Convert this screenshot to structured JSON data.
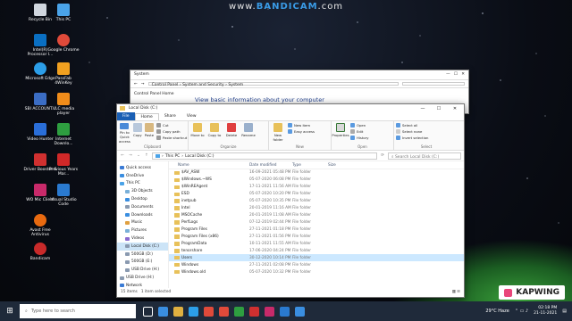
{
  "watermark": {
    "prefix": "www.",
    "brand": "BANDICAM",
    "suffix": ".com"
  },
  "desktop_icons": [
    {
      "label": "Recycle Bin",
      "color": "#d0d6de"
    },
    {
      "label": "This PC",
      "color": "#4aa3e8"
    },
    {
      "label": "Intel(R) Processor I...",
      "color": "#0a6fc2"
    },
    {
      "label": "Google Chrome",
      "color": "#e04a3a"
    },
    {
      "label": "Microsoft Edge",
      "color": "#2c9ee8"
    },
    {
      "label": "PassFab 4WinKey",
      "color": "#f0a020"
    },
    {
      "label": "SBI ACCOUNT...",
      "color": "#3b6dc4"
    },
    {
      "label": "VLC media player",
      "color": "#f08c1a"
    },
    {
      "label": "Video Hunter",
      "color": "#2a6ed8"
    },
    {
      "label": "Internet Downlo...",
      "color": "#2e9e40"
    },
    {
      "label": "Driver Booster 6",
      "color": "#d03030"
    },
    {
      "label": "Previous Years Mar...",
      "color": "#d02828"
    },
    {
      "label": "WO Mic Client",
      "color": "#c82a6a"
    },
    {
      "label": "Visual Studio Code",
      "color": "#2a7ad0"
    },
    {
      "label": "Avast Free Antivirus",
      "color": "#e86a10"
    },
    {
      "label": "Bandicam",
      "color": "#c82a2a"
    }
  ],
  "system_window": {
    "title": "System",
    "breadcrumb": [
      "Control Panel",
      "System and Security",
      "System"
    ],
    "side_link": "Control Panel Home",
    "heading": "View basic information about your computer"
  },
  "explorer": {
    "title": "Local Disk (C:)",
    "controls": {
      "minimize": "—",
      "maximize": "☐",
      "close": "✕"
    },
    "tabs": [
      "File",
      "Home",
      "Share",
      "View"
    ],
    "ribbon": {
      "clipboard": {
        "name": "Clipboard",
        "pin": "Pin to Quick access",
        "copy": "Copy",
        "paste": "Paste",
        "cut": "Cut",
        "copy_path": "Copy path",
        "paste_shortcut": "Paste shortcut"
      },
      "organize": {
        "name": "Organize",
        "move_to": "Move to",
        "copy_to": "Copy to",
        "delete": "Delete",
        "rename": "Rename"
      },
      "new": {
        "name": "New",
        "new_folder": "New folder",
        "new_item": "New item",
        "easy_access": "Easy access"
      },
      "open": {
        "name": "Open",
        "properties": "Properties",
        "open": "Open",
        "edit": "Edit",
        "history": "History"
      },
      "select": {
        "name": "Select",
        "select_all": "Select all",
        "select_none": "Select none",
        "invert": "Invert selection"
      }
    },
    "address": {
      "parts": [
        "This PC",
        "Local Disk (C:)"
      ],
      "search_placeholder": "Search Local Disk (C:)"
    },
    "nav_pane": [
      {
        "label": "Quick access",
        "color": "#3a7bd5"
      },
      {
        "label": "OneDrive",
        "color": "#3a8ee0"
      },
      {
        "label": "This PC",
        "color": "#4aa3e8"
      },
      {
        "label": "3D Objects",
        "color": "#7ab0d8"
      },
      {
        "label": "Desktop",
        "color": "#3a8ee0"
      },
      {
        "label": "Documents",
        "color": "#8a9ab0"
      },
      {
        "label": "Downloads",
        "color": "#3a8ee0"
      },
      {
        "label": "Music",
        "color": "#e0a040"
      },
      {
        "label": "Pictures",
        "color": "#7ab0d8"
      },
      {
        "label": "Videos",
        "color": "#8a6ad0"
      },
      {
        "label": "Local Disk (C:)",
        "color": "#8a9ab0"
      },
      {
        "label": "500GB (D:)",
        "color": "#8a9ab0"
      },
      {
        "label": "500GB (E:)",
        "color": "#8a9ab0"
      },
      {
        "label": "USB Drive (H:)",
        "color": "#8a9ab0"
      },
      {
        "label": "USB Drive (H:)",
        "color": "#8a9ab0"
      },
      {
        "label": "Network",
        "color": "#3a7bd5"
      }
    ],
    "columns": {
      "name": "Name",
      "date": "Date modified",
      "type": "Type",
      "size": "Size"
    },
    "files": [
      {
        "name": "$AV_ASW",
        "date": "16-09-2021 05:48 PM",
        "type": "File folder"
      },
      {
        "name": "$Windows.~WS",
        "date": "05-07-2020 06:08 PM",
        "type": "File folder"
      },
      {
        "name": "$WinREAgent",
        "date": "17-11-2021 11:56 AM",
        "type": "File folder"
      },
      {
        "name": "ESD",
        "date": "05-07-2020 10:20 PM",
        "type": "File folder"
      },
      {
        "name": "inetpub",
        "date": "05-07-2020 10:35 PM",
        "type": "File folder"
      },
      {
        "name": "Intel",
        "date": "20-01-2019 11:16 AM",
        "type": "File folder"
      },
      {
        "name": "MSOCache",
        "date": "20-01-2019 11:08 AM",
        "type": "File folder"
      },
      {
        "name": "PerfLogs",
        "date": "07-12-2019 02:44 PM",
        "type": "File folder"
      },
      {
        "name": "Program Files",
        "date": "27-11-2021 01:18 PM",
        "type": "File folder"
      },
      {
        "name": "Program Files (x86)",
        "date": "27-11-2021 01:56 PM",
        "type": "File folder"
      },
      {
        "name": "ProgramData",
        "date": "10-11-2021 11:55 AM",
        "type": "File folder"
      },
      {
        "name": "tenorshare",
        "date": "17-06-2020 04:24 PM",
        "type": "File folder"
      },
      {
        "name": "Users",
        "date": "30-12-2020 10:14 PM",
        "type": "File folder"
      },
      {
        "name": "Windows",
        "date": "27-11-2021 02:08 PM",
        "type": "File folder"
      },
      {
        "name": "Windows.old",
        "date": "05-07-2020 10:32 PM",
        "type": "File folder"
      }
    ],
    "selected_index": 12,
    "status": {
      "items": "15 items",
      "selected": "1 item selected"
    }
  },
  "taskbar": {
    "start": "⊞",
    "search_placeholder": "Type here to search",
    "apps": [
      "#ffffff",
      "#3a8ee0",
      "#e0b040",
      "#2c9ee8",
      "#e04a3a",
      "#e04a3a",
      "#2e9e40",
      "#d03030",
      "#c82a6a",
      "#2a7ad0",
      "#3a8ee0"
    ],
    "weather": "29°C Haze",
    "time": "02:18 PM",
    "date": "21-11-2021"
  },
  "kapwing": "KAPWING"
}
